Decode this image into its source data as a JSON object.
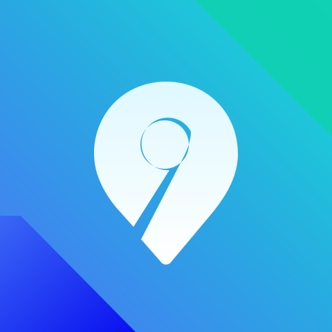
{
  "icon": {
    "semantic": "map-pin-icon",
    "colors": {
      "gradient_start": "#4a74f5",
      "gradient_mid": "#2aa7e2",
      "gradient_end": "#15dcd2",
      "corner_top_right": "#0fcfb0",
      "corner_bottom_left": "#0a10f0",
      "pin_top": "#dff8ff",
      "pin_bottom": "#ffffff",
      "pin_hole": "#2cb1e3"
    }
  }
}
